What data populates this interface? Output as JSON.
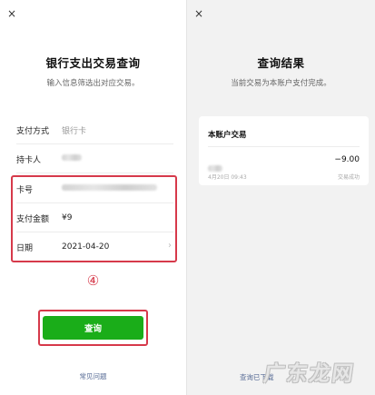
{
  "left": {
    "close": "×",
    "title": "银行支出交易查询",
    "subtitle": "输入信息筛选出对应交易。",
    "rows": [
      {
        "label": "支付方式",
        "value": "银行卡"
      },
      {
        "label": "持卡人",
        "value": ""
      },
      {
        "label": "卡号",
        "value": ""
      },
      {
        "label": "支付金额",
        "value": "¥9"
      },
      {
        "label": "日期",
        "value": "2021-04-20"
      }
    ],
    "chevron": "›",
    "step_marker": "④",
    "query_button": "查询",
    "faq": "常见问题"
  },
  "right": {
    "close": "×",
    "title": "查询结果",
    "subtitle": "当前交易为本账户支付完成。",
    "card_title": "本账户交易",
    "txn_date": "4月20日 09:43",
    "txn_amount": "−9.00",
    "txn_status": "交易成功",
    "bottom_link": "查询已下载"
  },
  "watermark": "广东龙网",
  "colors": {
    "highlight": "#d6394a",
    "button": "#1aad19",
    "link": "#576b95"
  }
}
